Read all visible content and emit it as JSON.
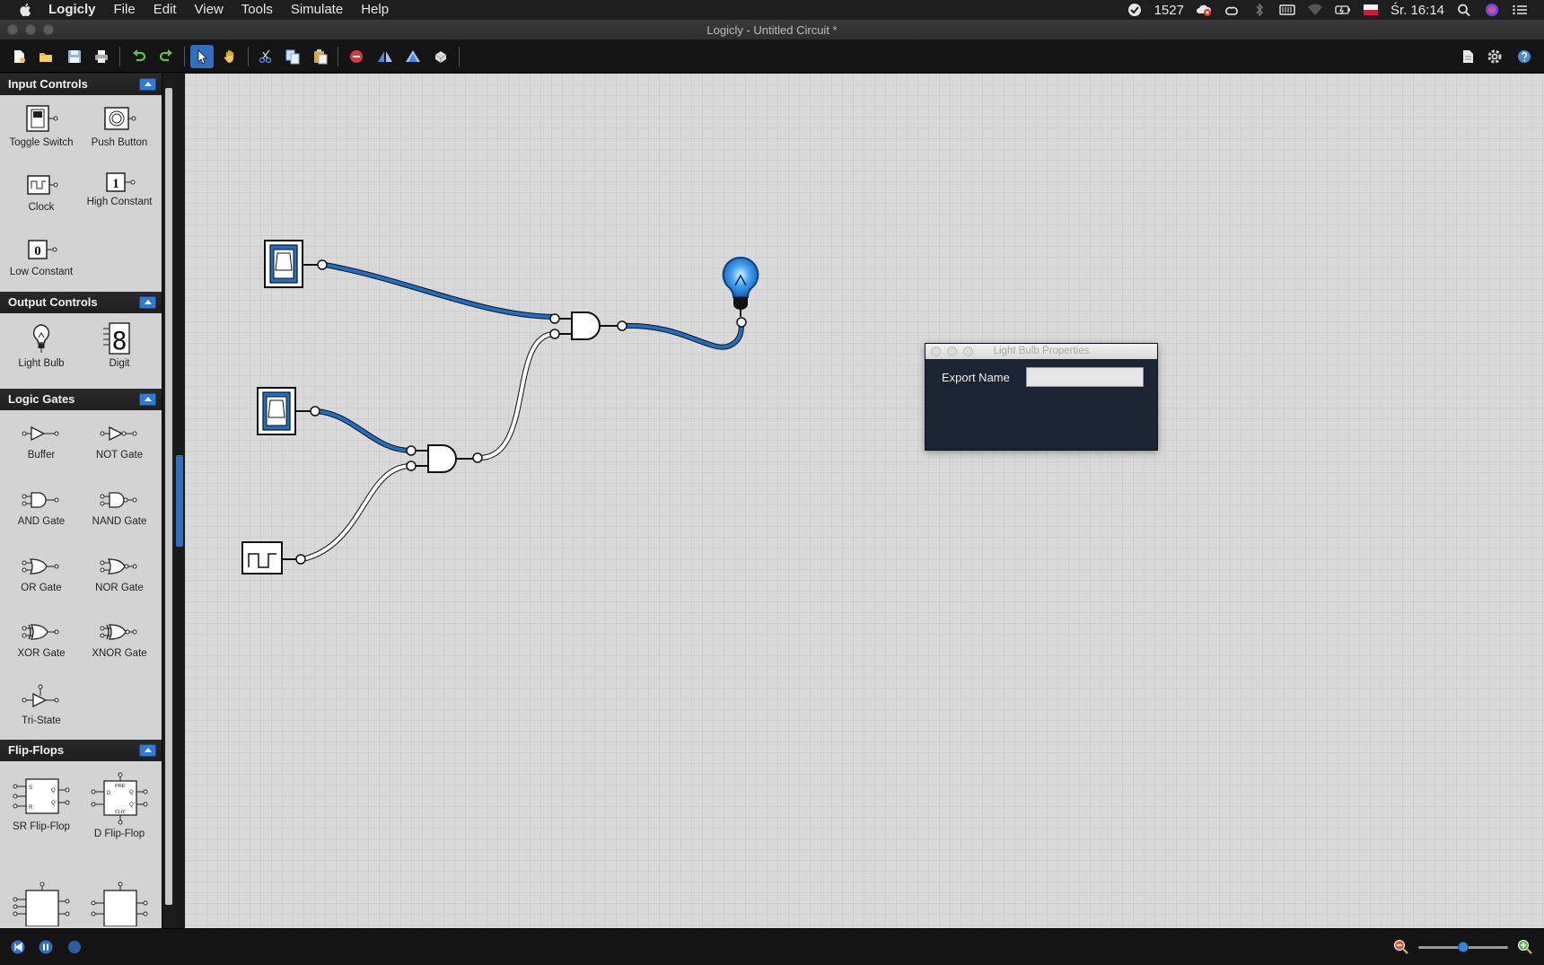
{
  "menubar": {
    "app_name": "Logicly",
    "items": [
      "File",
      "Edit",
      "View",
      "Tools",
      "Simulate",
      "Help"
    ],
    "status_count": "1527",
    "clock": "Śr. 16:14"
  },
  "window": {
    "title": "Logicly - Untitled Circuit *"
  },
  "sidebar": {
    "sections": [
      {
        "title": "Input Controls",
        "items": [
          "Toggle Switch",
          "Push Button",
          "Clock",
          "High Constant",
          "Low Constant"
        ]
      },
      {
        "title": "Output Controls",
        "items": [
          "Light Bulb",
          "Digit"
        ]
      },
      {
        "title": "Logic Gates",
        "items": [
          "Buffer",
          "NOT Gate",
          "AND Gate",
          "NAND Gate",
          "OR Gate",
          "NOR Gate",
          "XOR Gate",
          "XNOR Gate",
          "Tri-State"
        ]
      },
      {
        "title": "Flip-Flops",
        "items": [
          "SR Flip-Flop",
          "D Flip-Flop"
        ]
      }
    ],
    "constants": {
      "high": "1",
      "low": "0"
    },
    "digit_glyph": "8",
    "flipflop_pins": {
      "sr": [
        "S",
        "R",
        "Q",
        "Q'"
      ],
      "d": [
        "PRE'",
        "D",
        "CLR'",
        "Q",
        "Q'"
      ]
    }
  },
  "dialog": {
    "title": "Light Bulb Properties",
    "field_label": "Export Name",
    "field_value": ""
  },
  "colors": {
    "wire_active": "#1f6fc4",
    "accent": "#2f6fc0",
    "canvas": "#d9d9d9",
    "sidebar": "#d3d3d3",
    "dialog_bg": "#1b2433"
  },
  "zoom_level": 0.5
}
